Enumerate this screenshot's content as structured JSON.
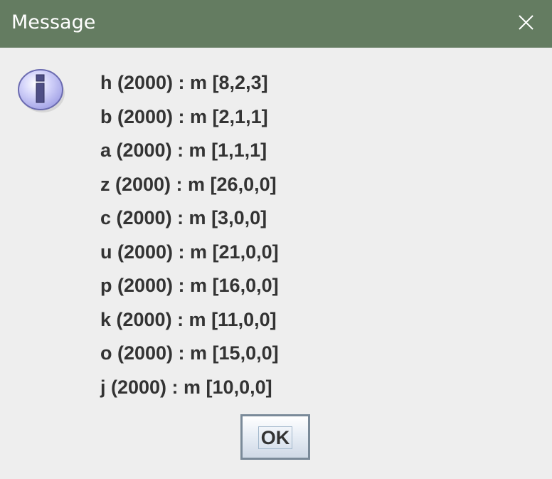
{
  "window": {
    "title": "Message",
    "close_icon": "close-icon",
    "titlebar_color": "#647c61"
  },
  "dialog": {
    "icon": "info-icon",
    "lines": [
      "h (2000) : m [8,2,3]",
      "b (2000) : m [2,1,1]",
      "a (2000) : m [1,1,1]",
      "z (2000) : m [26,0,0]",
      "c (2000) : m [3,0,0]",
      "u (2000) : m [21,0,0]",
      "p (2000) : m [16,0,0]",
      "k (2000) : m [11,0,0]",
      "o (2000) : m [15,0,0]",
      "j (2000) : m [10,0,0]"
    ],
    "ok_label": "OK"
  }
}
